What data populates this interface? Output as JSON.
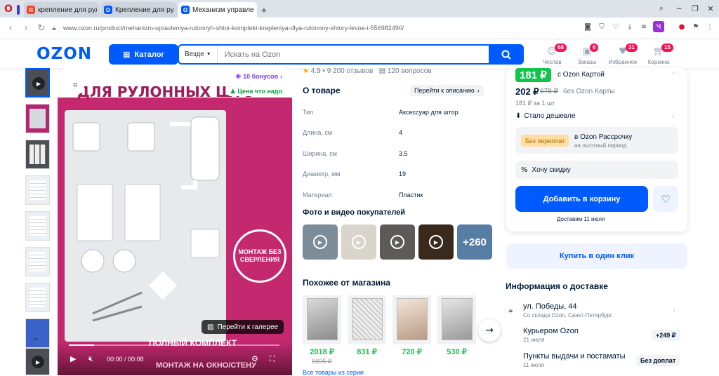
{
  "browser": {
    "tabs": [
      {
        "label": "крепление для рулонных",
        "favicon": "Я",
        "favicon_color": "#fc3f1d"
      },
      {
        "label": "Крепление для рулонных",
        "favicon": "O",
        "favicon_color": "#005bff"
      },
      {
        "label": "Механизм управления р",
        "favicon": "O",
        "favicon_color": "#005bff"
      }
    ],
    "new_tab": "+",
    "url": "www.ozon.ru/product/mehanizm-upravleniya-rulonnyh-shtor-komplekt-krepleniya-dlya-rulonnoy-shtory-levoe-i-556982490/",
    "profile_letter": "Ч"
  },
  "header": {
    "logo": "OZON",
    "catalog_label": "Каталог",
    "search_scope": "Везде",
    "search_placeholder": "Искать на Ozon",
    "icons": [
      {
        "label": "Чеслав",
        "badge": "68",
        "icon": "user-icon"
      },
      {
        "label": "Заказы",
        "badge": "6",
        "icon": "box-icon"
      },
      {
        "label": "Избранное",
        "badge": "31",
        "icon": "heart-icon"
      },
      {
        "label": "Корзина",
        "badge": "15",
        "icon": "cart-icon"
      }
    ]
  },
  "gallery": {
    "bonus_badge": "10 бонусов",
    "price_badge": "Цена что надо",
    "image_title": "ДЛЯ РУЛОННЫХ ШТО",
    "seal_text": "МОНТАЖ БЕЗ СВЕРЛЕНИЯ",
    "bottom_text_1": "ПОЛНЫЙ КОМПЛЕКТ",
    "bottom_text_2": "МОНТАЖ НА ОКНО/СТЕНУ",
    "gallery_button": "Перейти к галерее",
    "video_time": "00:00 / 00:08",
    "video_progress": 0.12
  },
  "product": {
    "rating": "4.9 • 9 200 отзывов",
    "questions": "120 вопросов",
    "about_title": "О товаре",
    "description_link": "Перейти к описанию",
    "attributes": [
      {
        "key": "Тип",
        "value": "Аксессуар для штор"
      },
      {
        "key": "Длина, см",
        "value": "4"
      },
      {
        "key": "Ширина, см",
        "value": "3.5"
      },
      {
        "key": "Диаметр, мм",
        "value": "19"
      },
      {
        "key": "Материал",
        "value": "Пластик"
      }
    ],
    "photos_title": "Фото и видео покупателей",
    "photos_more": "+260",
    "similar_title": "Похожее от магазина",
    "similar": [
      {
        "price": "2018 ₽",
        "old": "5695 ₽"
      },
      {
        "price": "831 ₽",
        "old": ""
      },
      {
        "price": "720 ₽",
        "old": ""
      },
      {
        "price": "530 ₽",
        "old": ""
      }
    ],
    "all_series": "Все товары из серии"
  },
  "buy": {
    "ozon_card_price": "181 ₽",
    "ozon_card_label": "с Ozon Картой",
    "price": "202 ₽",
    "old_price": "678 ₽",
    "price_note": "без Ozon Карты",
    "unit_price": "181 ₽ за 1 шт",
    "cheaper": "Стало дешевле",
    "installment_tag": "Без переплат",
    "installment_title": "в Ozon Рассрочку",
    "installment_sub": "на льготный период",
    "discount": "Хочу скидку",
    "add_to_cart": "Добавить в корзину",
    "delivery_date": "Доставим 11 июля",
    "one_click": "Купить в один клик"
  },
  "delivery": {
    "title": "Информация о доставке",
    "address": "ул. Победы, 44",
    "address_sub": "Со склада Ozon, Санкт-Петербург",
    "courier": "Курьером Ozon",
    "courier_date": "21 июля",
    "courier_price": "+249 ₽",
    "pickup": "Пункты выдачи и постаматы",
    "pickup_date": "11 июля",
    "pickup_price": "Без доплат"
  },
  "colors": {
    "brand": "#005bff",
    "green": "#10c44c",
    "badge": "#f91155"
  }
}
